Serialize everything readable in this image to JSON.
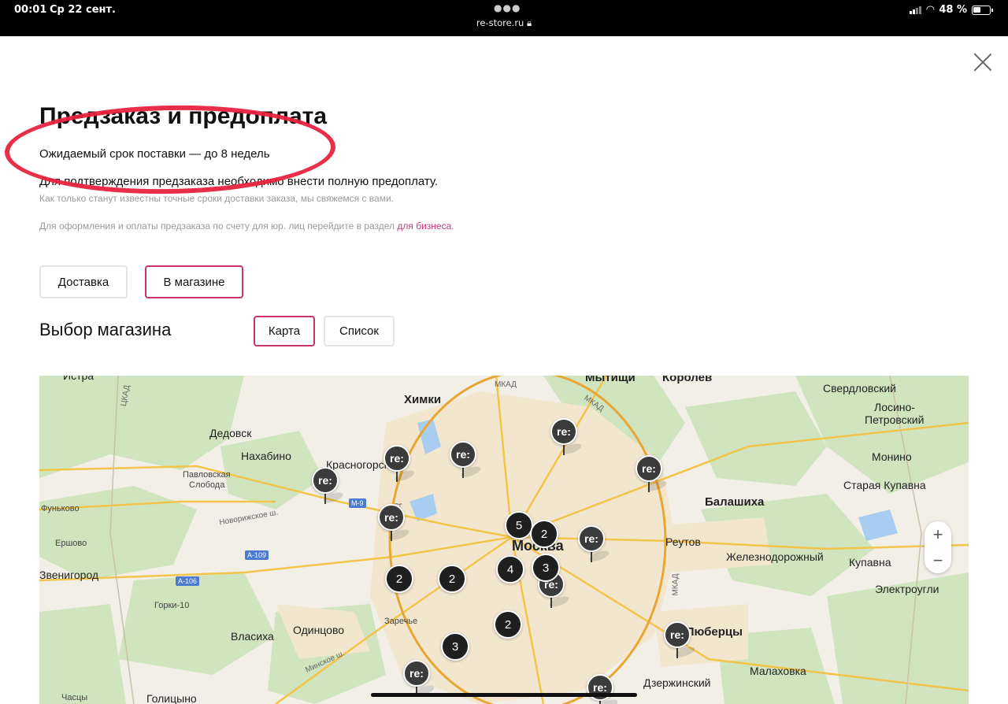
{
  "status": {
    "time": "00:01",
    "date": "Ср 22 сент.",
    "url": "re-store.ru",
    "battery": "48 %"
  },
  "modal": {
    "title": "Предзаказ и предоплата",
    "expected": "Ожидаемый срок поставки — до 8 недель",
    "prepay": "Для подтверждения предзаказа необходимо внести полную предоплату.",
    "contact": "Как только станут известны точные сроки доставки заказа, мы свяжемся с вами.",
    "business_prefix": "Для оформления и оплаты предзаказа по счету для юр. лиц перейдите в раздел ",
    "business_link": "для бизнеса",
    "business_suffix": "."
  },
  "tabs": {
    "delivery": "Доставка",
    "in_store": "В магазине"
  },
  "store_select": {
    "heading": "Выбор магазина",
    "map_label": "Карта",
    "list_label": "Список"
  },
  "map": {
    "places": {
      "khimki": "Химки",
      "mytishchi": "Мытищи",
      "korolev": "Королев",
      "sverdlovsky": "Свердловский",
      "losino1": "Лосино-",
      "losino2": "Петровский",
      "dedovsk": "Дедовск",
      "nakhabino": "Нахабино",
      "krasnogorsk": "Красногорск",
      "pavlovskaya1": "Павловская",
      "pavlovskaya2": "Слобода",
      "monino": "Монино",
      "staraya": "Старая Купавна",
      "balashikha": "Балашиха",
      "funkovo": "Фуньково",
      "ershovo": "Ершово",
      "moskva": "Москва",
      "reutov": "Реутов",
      "zheleznodorozhny": "Железнодорожный",
      "kupavna": "Купавна",
      "zvenigorod": "Звенигород",
      "gorki": "Горки-10",
      "elektrougli": "Электроугли",
      "zarechye": "Заречье",
      "vlasikha": "Власиха",
      "odintsovo": "Одинцово",
      "lyubertsy": "Люберцы",
      "dzerzhinsky": "Дзержинский",
      "malakhovka": "Малаховка",
      "chastsy": "Часцы",
      "golitsyno": "Голицыно",
      "istra": "Истра"
    },
    "roads": {
      "m9": "М-9",
      "a109": "А-109",
      "a106": "А-106",
      "ckad": "ЦКАД",
      "mkad": "МКАД",
      "novorizhskoe": "Новорижское ш.",
      "minskoe": "Минское ш."
    },
    "store_pin_label": "re:",
    "clusters": [
      "5",
      "2",
      "4",
      "3",
      "2",
      "2",
      "2",
      "3"
    ],
    "zoom_in": "+",
    "zoom_out": "−"
  }
}
